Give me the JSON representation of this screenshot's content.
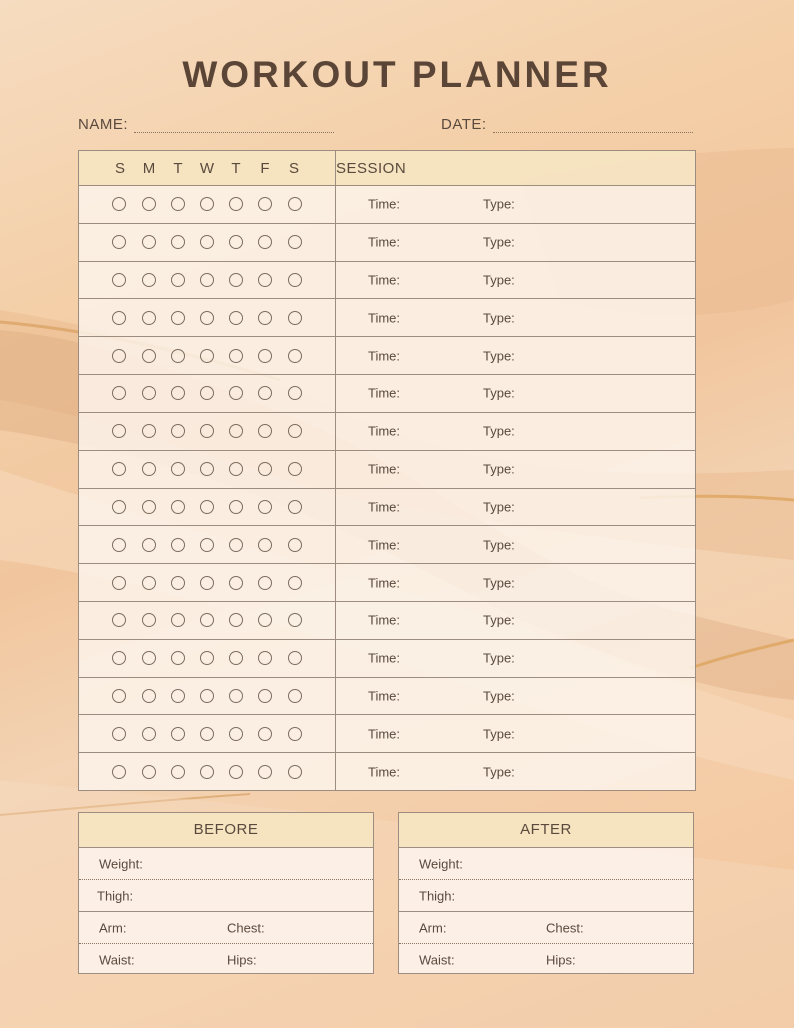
{
  "title": "WORKOUT PLANNER",
  "header": {
    "name_label": "NAME:",
    "date_label": "DATE:"
  },
  "planner": {
    "days": [
      "S",
      "M",
      "T",
      "W",
      "T",
      "F",
      "S"
    ],
    "session_header": "SESSION",
    "time_label": "Time:",
    "type_label": "Type:",
    "row_count": 16
  },
  "before": {
    "title": "BEFORE",
    "weight": "Weight:",
    "thigh": "Thigh:",
    "arm": "Arm:",
    "chest": "Chest:",
    "waist": "Waist:",
    "hips": "Hips:"
  },
  "after": {
    "title": "AFTER",
    "weight": "Weight:",
    "thigh": "Thigh:",
    "arm": "Arm:",
    "chest": "Chest:",
    "waist": "Waist:",
    "hips": "Hips:"
  },
  "colors": {
    "text": "#5a4a3e",
    "title": "#5b4536",
    "header_fill": "#f6e2be",
    "border": "#9d8d80",
    "background": "#f4cfa8"
  }
}
